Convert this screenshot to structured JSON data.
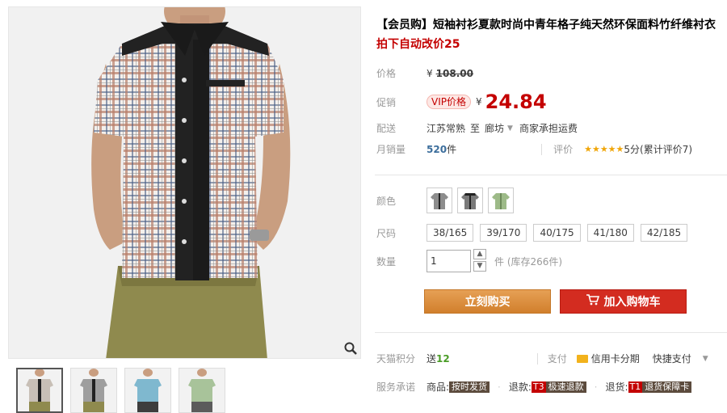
{
  "product": {
    "title": "【会员购】短袖衬衫夏款时尚中青年格子纯天然环保面料竹纤维衬衣",
    "subtitle": "拍下自动改价25"
  },
  "price": {
    "label": "价格",
    "currency": "¥",
    "original": "108.00"
  },
  "promo": {
    "label": "促销",
    "vip_badge": "VIP价格",
    "currency": "¥",
    "price": "24.84"
  },
  "shipping": {
    "label": "配送",
    "from": "江苏常熟",
    "to_word": "至",
    "destination": "廊坊",
    "fee": "商家承担运费"
  },
  "sales": {
    "label": "月销量",
    "count": "520",
    "unit": "件",
    "rating_label": "评价",
    "stars": "★★★★★",
    "rating_text": "5分(累计评价7)"
  },
  "color": {
    "label": "颜色",
    "options": [
      "gray-shirt",
      "gray-shirt-dark",
      "green-shirt"
    ]
  },
  "size": {
    "label": "尺码",
    "options": [
      "38/165",
      "39/170",
      "40/175",
      "41/180",
      "42/185"
    ]
  },
  "quantity": {
    "label": "数量",
    "value": "1",
    "unit_stock": "件 (库存266件)"
  },
  "actions": {
    "buy_now": "立刻购买",
    "add_cart": "加入购物车"
  },
  "points": {
    "label": "天猫积分",
    "prefix": "送",
    "value": "12",
    "pay_label": "支付",
    "credit_card": "信用卡分期",
    "quick_pay": "快捷支付"
  },
  "service": {
    "label": "服务承诺",
    "goods_label": "商品:",
    "goods_tag": "按时发货",
    "refund_label": "退款:",
    "refund_t": "T3",
    "refund_tag": "极速退款",
    "return_label": "退货:",
    "return_t": "T1",
    "return_tag": "退货保障卡"
  },
  "colors": {
    "accent_red": "#c40000",
    "buy_orange": "#e28f3d",
    "cart_red": "#d32c20",
    "shirt_black": "#222222"
  }
}
